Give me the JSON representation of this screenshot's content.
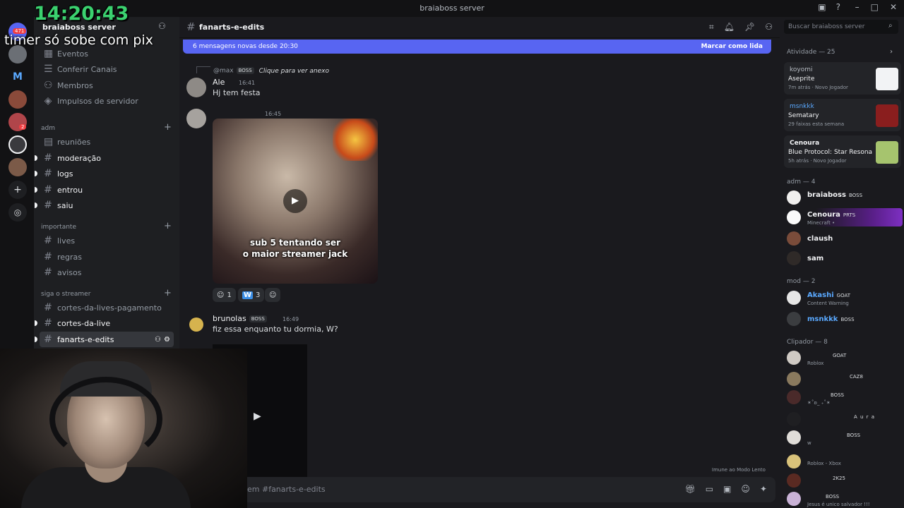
{
  "titlebar": {
    "title": "braiaboss server"
  },
  "overlay": {
    "timer": "14:20:43",
    "caption": "timer só sobe com pix"
  },
  "guilds": {
    "notif_count": "471",
    "dm_badge": "2",
    "m_letter": "M"
  },
  "sidebar": {
    "server_name": "braiaboss server",
    "top_items": [
      {
        "label": "Eventos"
      },
      {
        "label": "Conferir Canais"
      },
      {
        "label": "Membros"
      },
      {
        "label": "Impulsos de servidor"
      }
    ],
    "categories": [
      {
        "label": "adm",
        "channels": [
          "reuniões",
          "moderação",
          "logs",
          "entrou",
          "saiu"
        ]
      },
      {
        "label": "importante",
        "channels": [
          "lives",
          "regras",
          "avisos"
        ]
      },
      {
        "label": "siga o streamer",
        "channels": [
          "cortes-da-lives-pagamento",
          "cortes-da-live",
          "fanarts-e-edits"
        ]
      }
    ]
  },
  "header": {
    "channel": "fanarts-e-edits",
    "search_placeholder": "Buscar braiaboss server"
  },
  "new_messages": {
    "text": "6 mensagens novas desde 20:30",
    "action": "Marcar como lida"
  },
  "messages": [
    {
      "reply_user": "@max",
      "reply_tag": "BOSS",
      "reply_text": "Clique para ver anexo",
      "author": "Ale",
      "time": "16:41",
      "text": "Hj tem festa"
    },
    {
      "time": "16:45",
      "video_caption_1": "sub 5 tentando ser",
      "video_caption_2": "o maior streamer jack",
      "reactions": [
        {
          "count": "1"
        },
        {
          "emoji": "W",
          "count": "3"
        }
      ]
    },
    {
      "author": "brunolas",
      "tag": "BOSS",
      "time": "16:49",
      "text": "fiz essa enquanto tu dormia, W?"
    }
  ],
  "composer": {
    "placeholder": "em #fanarts-e-edits",
    "slow_mode": "Imune ao Modo Lento"
  },
  "members": {
    "activity_header": "Atividade — 25",
    "activities": [
      {
        "user": "koyomi",
        "game": "Aseprite",
        "meta1": "7m atrás",
        "meta2": "Novo Jogador"
      },
      {
        "user": "msnkkk",
        "game": "Sematary",
        "meta1": "29 faixas esta semana",
        "meta2": ""
      },
      {
        "user": "Cenoura",
        "game": "Blue Protocol: Star Resona…",
        "meta1": "5h atrás",
        "meta2": "Novo Jogador"
      }
    ],
    "groups": [
      {
        "header": "adm — 4",
        "members": [
          {
            "name": "braiaboss",
            "badge": "BOSS",
            "sub": ""
          },
          {
            "name": "Cenoura",
            "badge": "PRTS",
            "sub": "Minecraft •"
          },
          {
            "name": "claush",
            "badge": "",
            "sub": ""
          },
          {
            "name": "sam",
            "badge": "",
            "sub": ""
          }
        ]
      },
      {
        "header": "mod — 2",
        "members": [
          {
            "name": "Akashi",
            "badge": "GOAT",
            "sub": "Content Warning"
          },
          {
            "name": "msnkkk",
            "badge": "BOSS",
            "sub": ""
          }
        ]
      },
      {
        "header": "Clipador — 8",
        "members": [
          {
            "name": "",
            "badge": "GOAT",
            "sub": "Roblox"
          },
          {
            "name": "",
            "badge": "CAZ8",
            "sub": ""
          },
          {
            "name": "",
            "badge": "BOSS",
            "sub": "✶˚ʚ_ ₊˚✶"
          },
          {
            "name": "",
            "badge": "A u r a",
            "sub": ""
          },
          {
            "name": "",
            "badge": "BOSS",
            "sub": "w"
          },
          {
            "name": "",
            "badge": "",
            "sub": "Roblox - Xbox"
          },
          {
            "name": "",
            "badge": "2K25",
            "sub": ""
          },
          {
            "name": "",
            "badge": "BOSS",
            "sub": "Jesus é unico salvador !!!"
          }
        ]
      }
    ]
  }
}
